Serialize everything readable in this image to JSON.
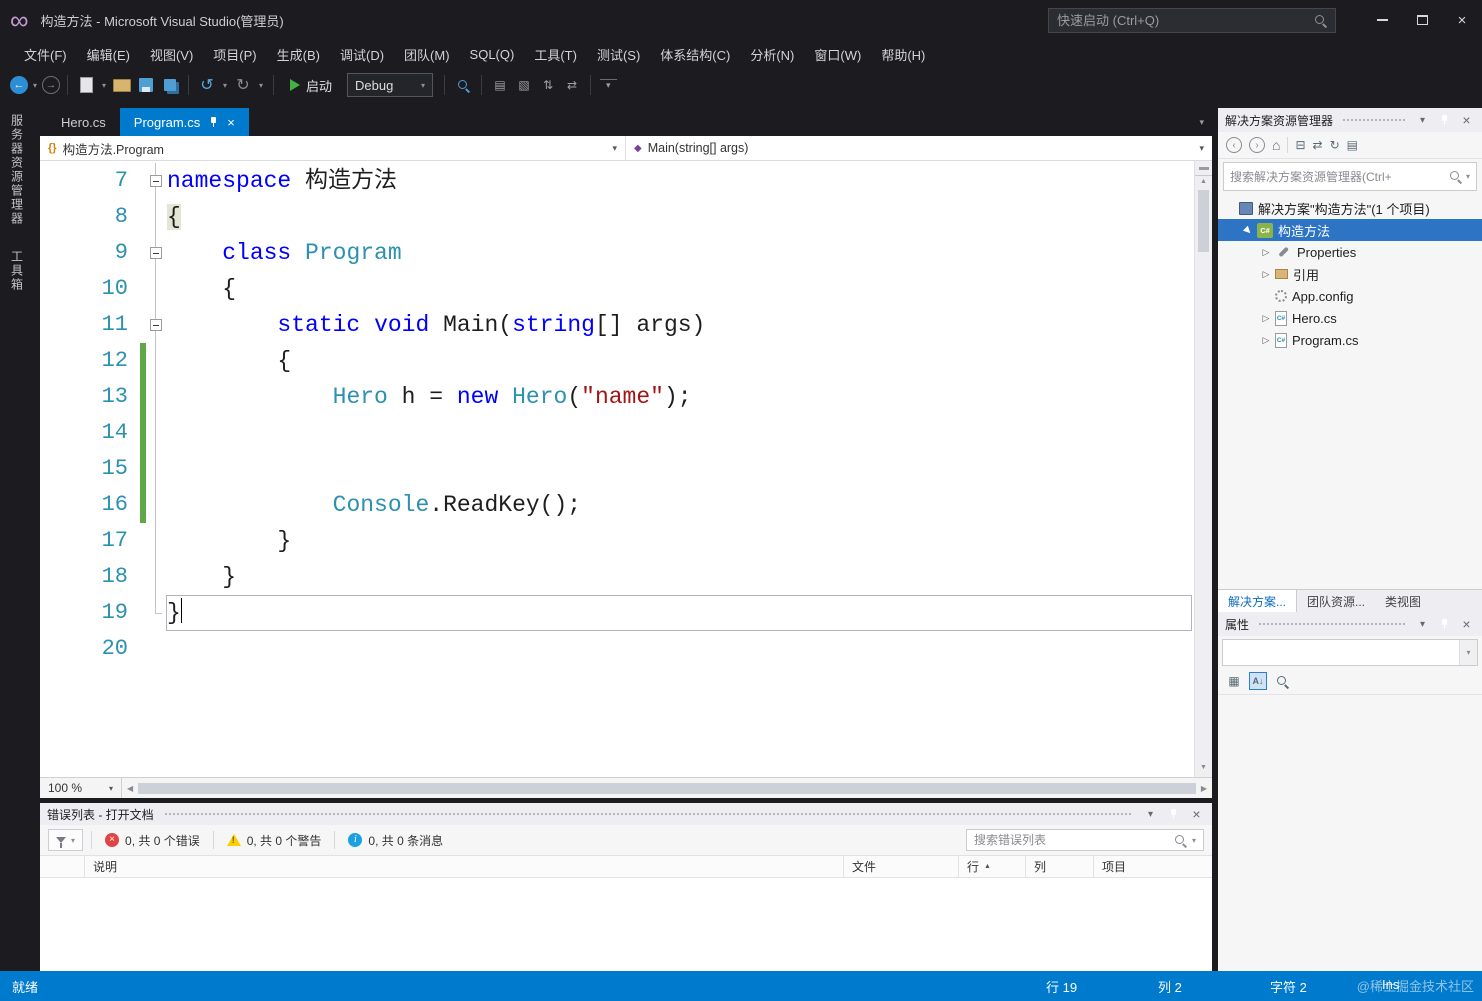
{
  "window": {
    "title": "构造方法 - Microsoft Visual Studio(管理员)",
    "quick_launch_placeholder": "快速启动 (Ctrl+Q)"
  },
  "icons": {
    "vs_logo": "∞",
    "dropdown": "▾",
    "close": "×",
    "back_arrow": "←",
    "forward_arrow": "→",
    "undo": "↺",
    "redo": "↻",
    "home": "⌂",
    "collapse_all": "⊟",
    "sync": "⇄",
    "refresh": "↻",
    "show_all_files": "▤",
    "doc_lines": "▤",
    "doc_hatch": "▧",
    "arrows_ud": "⇅",
    "arrows_lr": "⇄",
    "scroll_up": "▲",
    "scroll_down": "▼",
    "scroll_left": "◀",
    "scroll_right": "▶",
    "sort_asc": "▲",
    "categorize": "▦",
    "sort_alpha": "A↓",
    "namespace_symbol": "{}",
    "method_symbol": "◆",
    "chevron_left": "‹",
    "chevron_right": "›"
  },
  "menu": [
    "文件(F)",
    "编辑(E)",
    "视图(V)",
    "项目(P)",
    "生成(B)",
    "调试(D)",
    "团队(M)",
    "SQL(Q)",
    "工具(T)",
    "测试(S)",
    "体系结构(C)",
    "分析(N)",
    "窗口(W)",
    "帮助(H)"
  ],
  "toolbar": {
    "start_label": "启动",
    "debug_target": "Debug"
  },
  "side_strip": {
    "tabs": [
      "服务器资源管理器",
      "工具箱"
    ]
  },
  "document_tabs": {
    "inactive": "Hero.cs",
    "active": "Program.cs"
  },
  "breadcrumb": {
    "type_name": "构造方法.Program",
    "member_name": "Main(string[] args)"
  },
  "editor": {
    "zoom": "100 %",
    "lines": [
      {
        "num": "7",
        "fold": "box",
        "tokens": [
          {
            "t": "namespace",
            "c": "kw"
          },
          {
            "t": " 构造方法",
            "c": "pl"
          }
        ]
      },
      {
        "num": "8",
        "fold": "line",
        "tokens": [
          {
            "t": "{",
            "c": "bm"
          }
        ]
      },
      {
        "num": "9",
        "fold": "box",
        "tokens": [
          {
            "t": "    ",
            "c": "pl"
          },
          {
            "t": "class",
            "c": "kw"
          },
          {
            "t": " ",
            "c": "pl"
          },
          {
            "t": "Program",
            "c": "ty"
          }
        ]
      },
      {
        "num": "10",
        "fold": "line",
        "tokens": [
          {
            "t": "    {",
            "c": "pl"
          }
        ]
      },
      {
        "num": "11",
        "fold": "box",
        "tokens": [
          {
            "t": "        ",
            "c": "pl"
          },
          {
            "t": "static",
            "c": "kw"
          },
          {
            "t": " ",
            "c": "pl"
          },
          {
            "t": "void",
            "c": "kw"
          },
          {
            "t": " Main(",
            "c": "pl"
          },
          {
            "t": "string",
            "c": "kw"
          },
          {
            "t": "[] args)",
            "c": "pl"
          }
        ]
      },
      {
        "num": "12",
        "fold": "line",
        "changed": true,
        "tokens": [
          {
            "t": "        {",
            "c": "pl"
          }
        ]
      },
      {
        "num": "13",
        "fold": "line",
        "changed": true,
        "tokens": [
          {
            "t": "            ",
            "c": "pl"
          },
          {
            "t": "Hero",
            "c": "ty"
          },
          {
            "t": " h = ",
            "c": "pl"
          },
          {
            "t": "new",
            "c": "kw"
          },
          {
            "t": " ",
            "c": "pl"
          },
          {
            "t": "Hero",
            "c": "ty"
          },
          {
            "t": "(",
            "c": "pl"
          },
          {
            "t": "\"name\"",
            "c": "str"
          },
          {
            "t": ");",
            "c": "pl"
          }
        ]
      },
      {
        "num": "14",
        "fold": "line",
        "changed": true,
        "tokens": []
      },
      {
        "num": "15",
        "fold": "line",
        "changed": true,
        "tokens": []
      },
      {
        "num": "16",
        "fold": "line",
        "changed": true,
        "tokens": [
          {
            "t": "            ",
            "c": "pl"
          },
          {
            "t": "Console",
            "c": "ty"
          },
          {
            "t": ".ReadKey();",
            "c": "pl"
          }
        ]
      },
      {
        "num": "17",
        "fold": "line",
        "tokens": [
          {
            "t": "        }",
            "c": "pl"
          }
        ]
      },
      {
        "num": "18",
        "fold": "line",
        "tokens": [
          {
            "t": "    }",
            "c": "pl"
          }
        ]
      },
      {
        "num": "19",
        "fold": "end",
        "current": true,
        "cursor": true,
        "tokens": [
          {
            "t": "}",
            "c": "pl"
          }
        ]
      },
      {
        "num": "20",
        "tokens": []
      }
    ]
  },
  "error_list": {
    "title": "错误列表 - 打开文档",
    "errors": "0, 共 0 个错误",
    "warnings": "0, 共 0 个警告",
    "messages": "0, 共 0 条消息",
    "search_placeholder": "搜索错误列表",
    "columns": [
      "说明",
      "文件",
      "行",
      "列",
      "项目"
    ]
  },
  "solution_explorer": {
    "title": "解决方案资源管理器",
    "search_placeholder": "搜索解决方案资源管理器(Ctrl+ ",
    "items": [
      {
        "label": "解决方案\"构造方法\"(1 个项目)",
        "indent": 0,
        "icon": "solution",
        "arrow": "none",
        "selected": false
      },
      {
        "label": "构造方法",
        "indent": 1,
        "icon": "csproject",
        "arrow": "expanded",
        "selected": true,
        "glyph": "C#"
      },
      {
        "label": "Properties",
        "indent": 2,
        "icon": "properties",
        "arrow": "collapsed",
        "selected": false
      },
      {
        "label": "引用",
        "indent": 2,
        "icon": "references",
        "arrow": "collapsed",
        "selected": false
      },
      {
        "label": "App.config",
        "indent": 2,
        "icon": "config",
        "arrow": "none",
        "selected": false
      },
      {
        "label": "Hero.cs",
        "indent": 2,
        "icon": "csfile",
        "arrow": "collapsed",
        "selected": false,
        "glyph": "C#"
      },
      {
        "label": "Program.cs",
        "indent": 2,
        "icon": "csfile",
        "arrow": "collapsed",
        "selected": false,
        "glyph": "C#"
      }
    ],
    "bottom_tabs": [
      "解决方案...",
      "团队资源...",
      "类视图"
    ]
  },
  "properties_panel": {
    "title": "属性"
  },
  "status_bar": {
    "ready": "就绪",
    "line": "行 19",
    "column": "列 2",
    "character": "字符 2",
    "mode": "Ins",
    "watermark": "@稀土掘金技术社区"
  },
  "colors": {
    "accent": "#007acc",
    "keyword": "#0000ff",
    "type_name": "#2b91af",
    "string_literal": "#a31515",
    "line_number": "#2b91af",
    "changed_bar": "#5fa848",
    "selection": "#2d74c4"
  }
}
